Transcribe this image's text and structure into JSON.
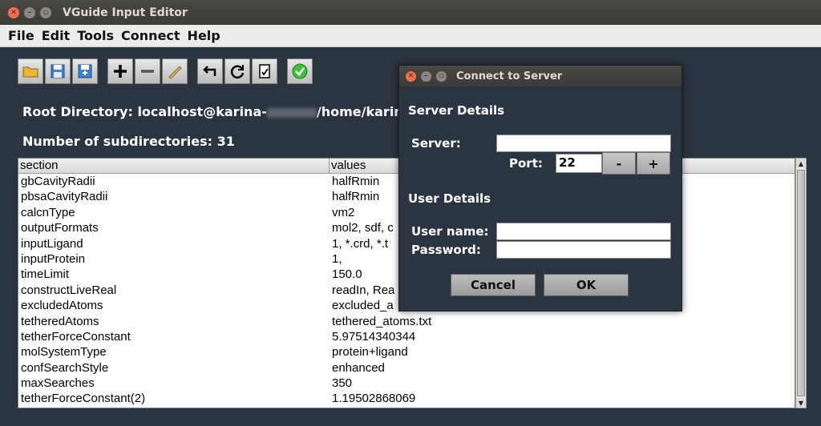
{
  "window": {
    "title": "VGuide Input Editor"
  },
  "menu": [
    "File",
    "Edit",
    "Tools",
    "Connect",
    "Help"
  ],
  "info": {
    "root_prefix": "Root Directory: localhost@karina-",
    "root_suffix": "/home/karina",
    "subdirs": "Number of subdirectories: 31"
  },
  "table": {
    "headers": [
      "section",
      "values"
    ],
    "rows": [
      [
        "gbCavityRadii",
        "halfRmin"
      ],
      [
        "pbsaCavityRadii",
        "halfRmin"
      ],
      [
        "calcnType",
        "vm2"
      ],
      [
        "outputFormats",
        "mol2, sdf, c"
      ],
      [
        "inputLigand",
        "1, *.crd, *.t"
      ],
      [
        "inputProtein",
        "1,"
      ],
      [
        "timeLimit",
        "150.0"
      ],
      [
        "constructLiveReal",
        "readIn, Rea"
      ],
      [
        "excludedAtoms",
        "excluded_a"
      ],
      [
        "tetheredAtoms",
        "tethered_atoms.txt"
      ],
      [
        "tetherForceConstant",
        "5.97514340344"
      ],
      [
        "molSystemType",
        "protein+ligand"
      ],
      [
        "confSearchStyle",
        "enhanced"
      ],
      [
        "maxSearches",
        "350"
      ],
      [
        "tetherForceConstant(2)",
        "1.19502868069"
      ]
    ]
  },
  "dialog": {
    "title": "Connect to Server",
    "server_details": "Server Details",
    "server_label": "Server:",
    "server_value": "",
    "port_label": "Port:",
    "port_value": "22",
    "minus": "-",
    "plus": "+",
    "user_details": "User Details",
    "username_label": "User name:",
    "username_value": "",
    "password_label": "Password:",
    "password_value": "",
    "cancel": "Cancel",
    "ok": "OK"
  },
  "colors": {
    "background": "#2b3441",
    "titlebar": "#3c3b37",
    "close": "#f26d4e"
  }
}
